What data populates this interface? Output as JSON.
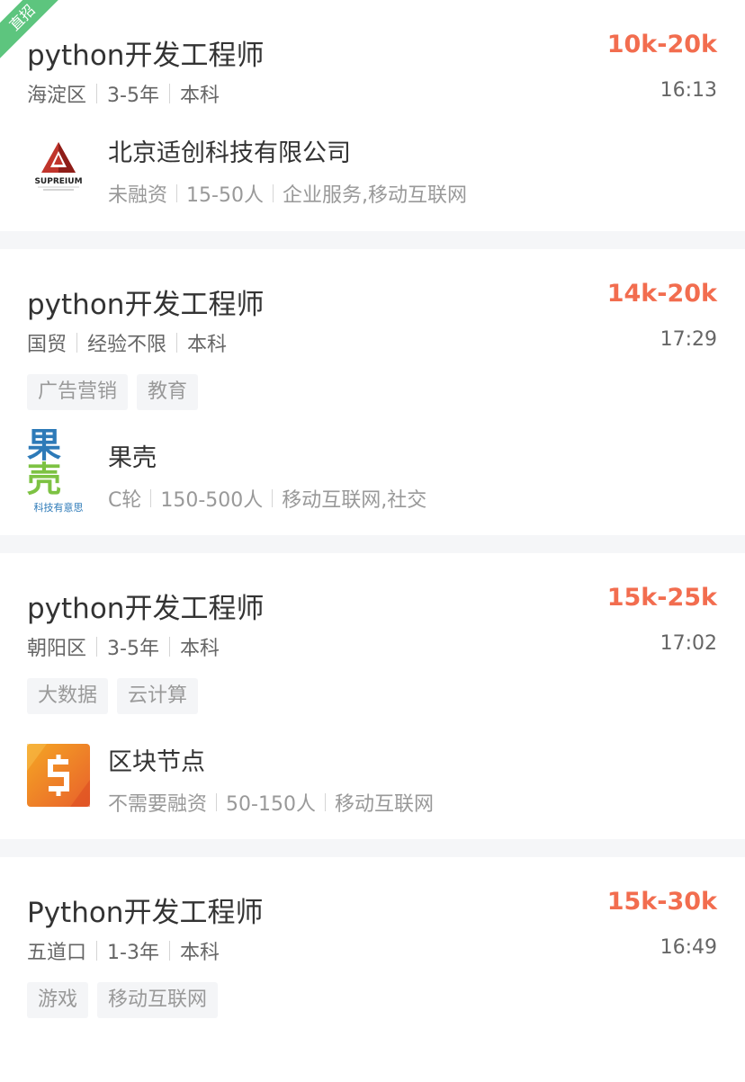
{
  "jobs": [
    {
      "ribbon": "直招",
      "title": "python开发工程师",
      "salary": "10k-20k",
      "location": "海淀区",
      "experience": "3-5年",
      "education": "本科",
      "time": "16:13",
      "tags": [],
      "company": {
        "name": "北京适创科技有限公司",
        "funding": "未融资",
        "size": "15-50人",
        "industry": "企业服务,移动互联网",
        "logo_text": "SUPREIUM",
        "logo_icon": "supreium-pyramid-logo"
      }
    },
    {
      "title": "python开发工程师",
      "salary": "14k-20k",
      "location": "国贸",
      "experience": "经验不限",
      "education": "本科",
      "time": "17:29",
      "tags": [
        "广告营销",
        "教育"
      ],
      "company": {
        "name": "果壳",
        "funding": "C轮",
        "size": "150-500人",
        "industry": "移动互联网,社交",
        "logo_text_1": "果",
        "logo_text_2": "壳",
        "logo_subtitle": "科技有意思"
      }
    },
    {
      "title": "python开发工程师",
      "salary": "15k-25k",
      "location": "朝阳区",
      "experience": "3-5年",
      "education": "本科",
      "time": "17:02",
      "tags": [
        "大数据",
        "云计算"
      ],
      "company": {
        "name": "区块节点",
        "funding": "不需要融资",
        "size": "50-150人",
        "industry": "移动互联网",
        "logo_icon": "blockchain-node-logo"
      }
    },
    {
      "title": "Python开发工程师",
      "salary": "15k-30k",
      "location": "五道口",
      "experience": "1-3年",
      "education": "本科",
      "time": "16:49",
      "tags": [
        "游戏",
        "移动互联网"
      ]
    }
  ],
  "colors": {
    "salary": "#f26d4f",
    "ribbon": "#5dc57e",
    "guoke_blue": "#2d7ab8",
    "guoke_green": "#7dc243"
  }
}
